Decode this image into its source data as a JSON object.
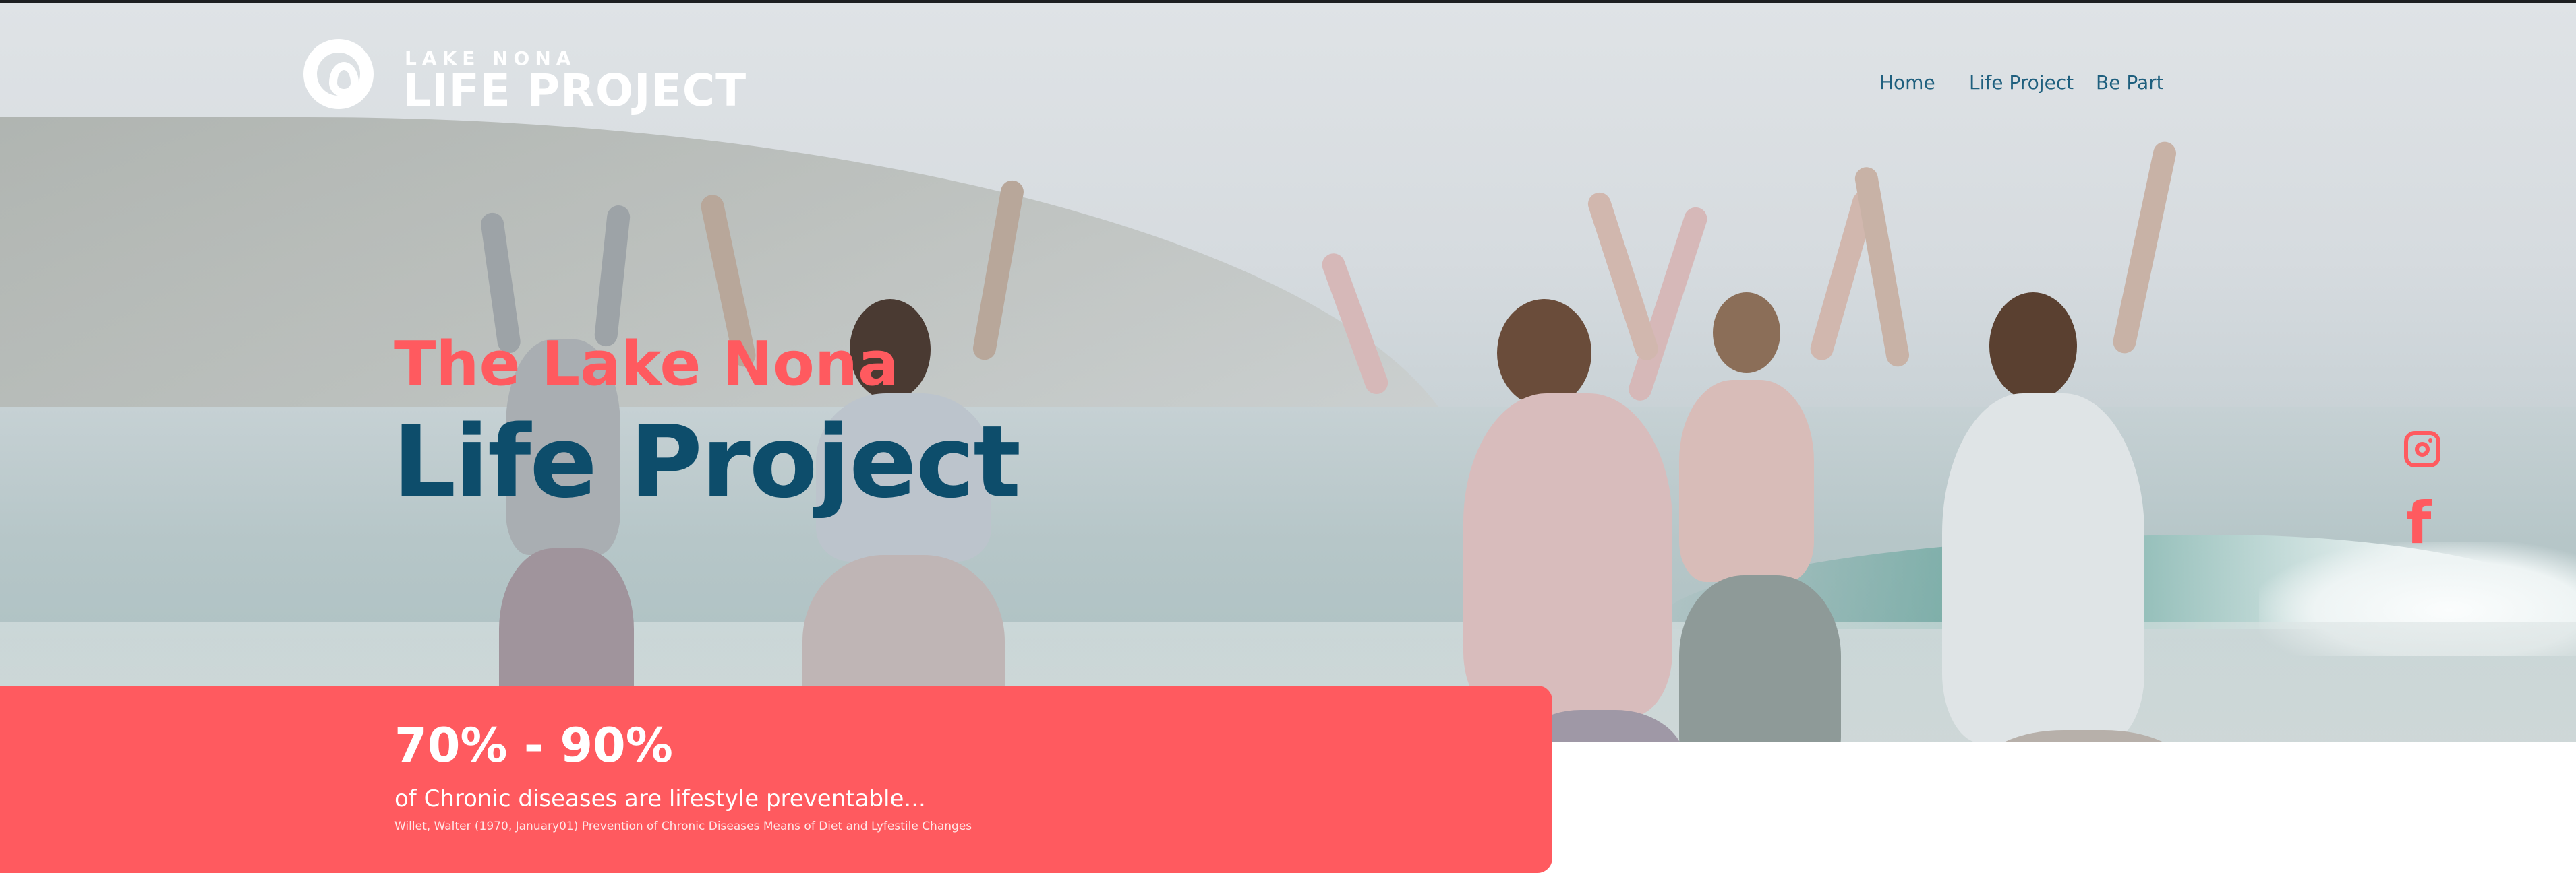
{
  "header": {
    "logo": {
      "top_line": "LAKE NONA",
      "main_line": "LIFE PROJECT"
    },
    "nav": [
      {
        "label": "Home"
      },
      {
        "label": "Life Project"
      },
      {
        "label": "Be Part"
      }
    ]
  },
  "hero": {
    "eyebrow": "The Lake Nona",
    "title": "Life Project"
  },
  "social": [
    {
      "icon": "instagram-icon"
    },
    {
      "icon": "facebook-icon"
    }
  ],
  "stats": {
    "value": "70% - 90%",
    "description": "of Chronic diseases are lifestyle preventable...",
    "citation": "Willet, Walter (1970, January01) Prevention of Chronic Diseases Means of Diet and Lyfestile Changes"
  },
  "colors": {
    "accent": "#ff5a5f",
    "primary": "#0d4d6b",
    "nav_text": "#1e5f7e"
  }
}
